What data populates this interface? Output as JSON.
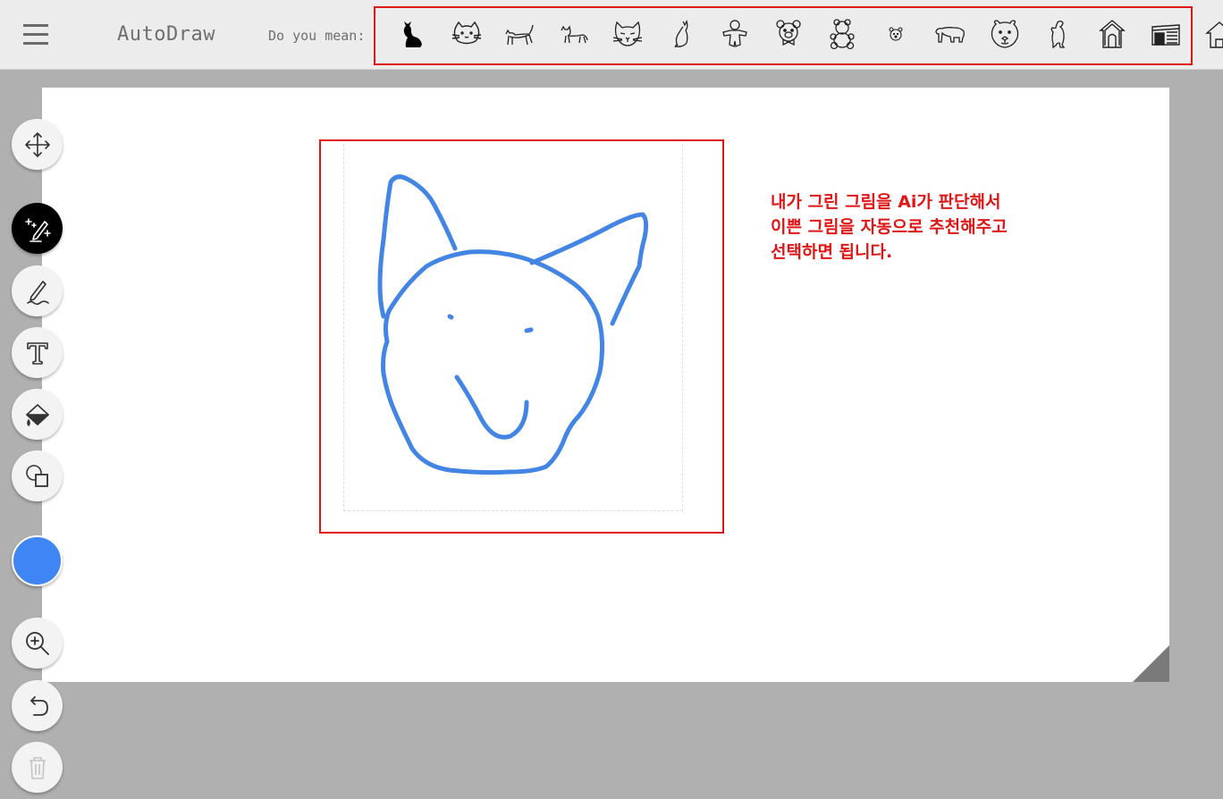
{
  "app": {
    "title": "AutoDraw"
  },
  "suggestions_bar": {
    "label": "Do you mean:",
    "items": [
      {
        "icon": "cat-silhouette-icon"
      },
      {
        "icon": "cat-face-icon"
      },
      {
        "icon": "cat-walking-icon"
      },
      {
        "icon": "cat-walking-small-icon"
      },
      {
        "icon": "cat-head-detailed-icon"
      },
      {
        "icon": "cat-sitting-icon"
      },
      {
        "icon": "gingerbread-figure-icon"
      },
      {
        "icon": "bear-face-bowtie-icon"
      },
      {
        "icon": "teddy-bear-icon"
      },
      {
        "icon": "small-bear-face-icon"
      },
      {
        "icon": "polar-bear-icon"
      },
      {
        "icon": "bear-head-icon"
      },
      {
        "icon": "standing-bear-icon"
      },
      {
        "icon": "dog-house-icon"
      },
      {
        "icon": "kennel-icon"
      },
      {
        "icon": "house-icon"
      }
    ]
  },
  "toolbar": {
    "tools": [
      {
        "name": "move-tool",
        "icon": "move-arrows-icon",
        "active": false
      },
      {
        "name": "autodraw-tool",
        "icon": "magic-pen-icon",
        "active": true
      },
      {
        "name": "draw-tool",
        "icon": "pencil-icon",
        "active": false
      },
      {
        "name": "type-tool",
        "icon": "text-icon",
        "active": false
      },
      {
        "name": "fill-tool",
        "icon": "paint-bucket-icon",
        "active": false
      },
      {
        "name": "shape-tool",
        "icon": "shapes-icon",
        "active": false
      },
      {
        "name": "zoom-tool",
        "icon": "zoom-in-icon",
        "active": false
      },
      {
        "name": "undo-tool",
        "icon": "undo-icon",
        "active": false
      },
      {
        "name": "delete-tool",
        "icon": "trash-icon",
        "active": false
      }
    ],
    "current_color": "#3f85f4"
  },
  "annotation": {
    "lines": [
      "내가 그린 그림을 Ai가 판단해서",
      "이쁜 그림을 자동으로 추천해주고",
      "선택하면 됩니다."
    ],
    "color": "#e01515"
  },
  "colors": {
    "highlight": "#e01515",
    "stroke": "#3f85f4",
    "background": "#b0b0b0"
  }
}
